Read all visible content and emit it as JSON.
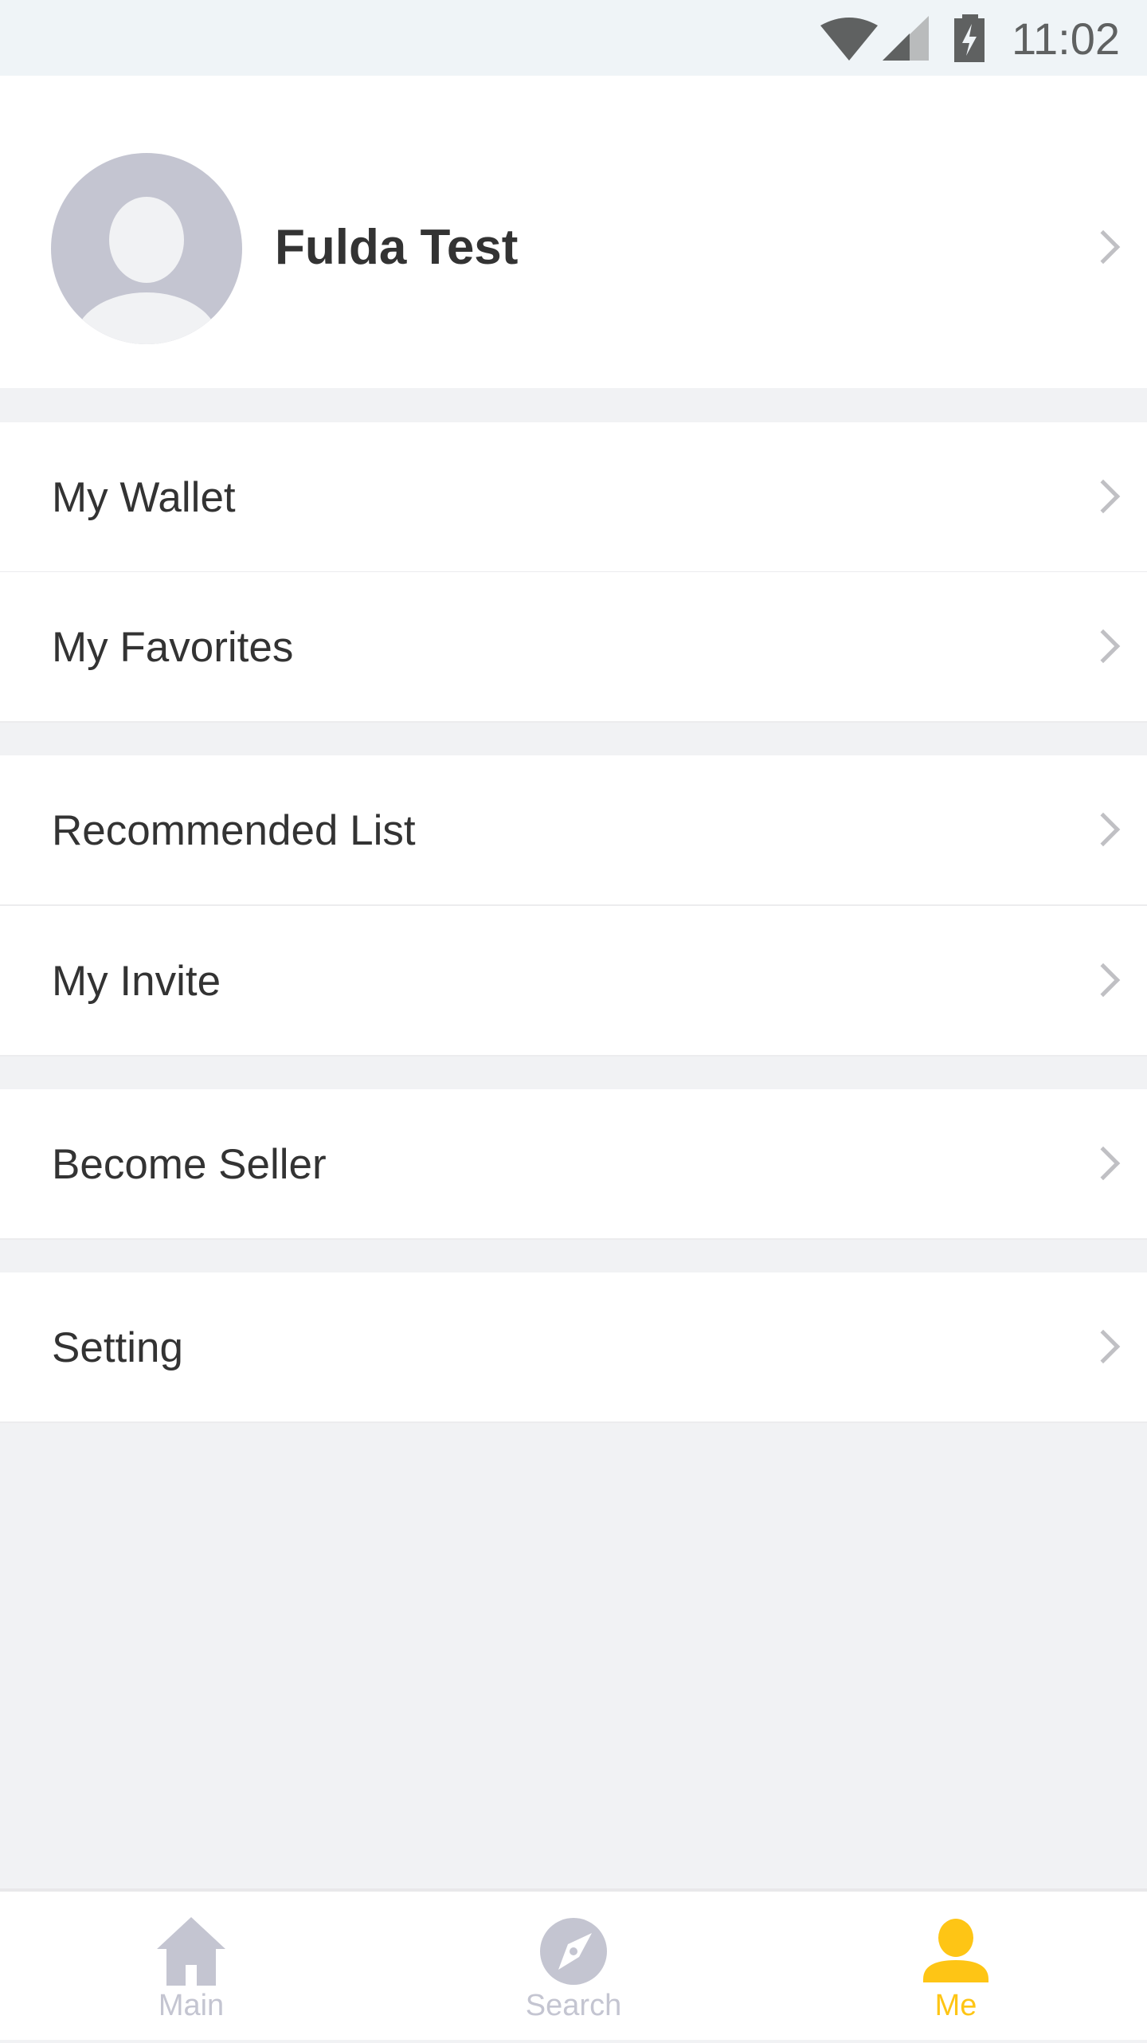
{
  "status_bar": {
    "time": "11:02"
  },
  "profile": {
    "name": "Fulda Test"
  },
  "menu": [
    {
      "label": "My Wallet"
    },
    {
      "label": "My Favorites"
    },
    {
      "label": "Recommended List"
    },
    {
      "label": "My Invite"
    },
    {
      "label": "Become Seller"
    },
    {
      "label": "Setting"
    }
  ],
  "nav": {
    "tabs": [
      {
        "label": "Main",
        "icon": "home-icon"
      },
      {
        "label": "Search",
        "icon": "compass-icon"
      },
      {
        "label": "Me",
        "icon": "person-icon",
        "active": true
      }
    ]
  },
  "colors": {
    "accent": "#fec515",
    "inactive": "#c4c5d1"
  }
}
